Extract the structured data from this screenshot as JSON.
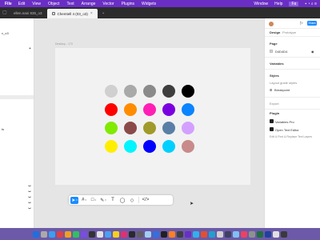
{
  "menubar": {
    "app": "File",
    "menus": [
      "Edit",
      "View",
      "Object",
      "Text",
      "Arrange",
      "Vector",
      "Plugins",
      "Widgets"
    ],
    "right": [
      "Window",
      "Help"
    ],
    "selected": "Fa"
  },
  "tabs": [
    {
      "label": "ellen.nani 835_o3"
    },
    {
      "label": "Chemtell 4 (03_o3)"
    }
  ],
  "canvas": {
    "frame_label": "Desktop - 170",
    "dots": [
      "#d0d0d0",
      "#a9a9a9",
      "#8a8a8a",
      "#3e3e3e",
      "#000000",
      "#ff0000",
      "#ff8c00",
      "#ff1fb4",
      "#7b00e0",
      "#0a84ff",
      "#80ea00",
      "#8b4a4a",
      "#a09a2a",
      "#5a7fa6",
      "#d4a0ff",
      "#ffee00",
      "#00f5ff",
      "#0000ff",
      "#00d0ff",
      "#c98a8a"
    ]
  },
  "left_panel": {
    "title": "v_o3",
    "items": [
      "",
      "",
      "ts",
      ""
    ]
  },
  "right_panel": {
    "share": "Share",
    "tabs": {
      "design": "Design",
      "prototype": "Prototype"
    },
    "page_heading": "Page",
    "page_color": "D4D4D4",
    "variables": "Variables",
    "styles_heading": "Styles",
    "layout_guide": "Layout guide styles",
    "breakpoint": "Breakpoint",
    "export": "Export",
    "plugin_heading": "Plugin",
    "plugins": [
      "Variables Pro",
      "Open Text Editor",
      "Edit & Find & Replace Text Layers"
    ]
  },
  "toolbar": {
    "tools": [
      "move",
      "frame",
      "shape",
      "pen",
      "text",
      "comment",
      "actions",
      "dev-mode"
    ]
  },
  "dock": {
    "icons": [
      "#1e6fe0",
      "#aaaaaa",
      "#3c9ef0",
      "#e04040",
      "#f0a020",
      "#30c060",
      "#7a4de0",
      "#333333",
      "#e0e0e0",
      "#4aa0f0",
      "#f5d020",
      "#e03070",
      "#2a2a2a",
      "#606060",
      "#a0d0f0",
      "#3070e0",
      "#202020",
      "#ff8020",
      "#404040",
      "#6a2ec5",
      "#30b0f0",
      "#e05030",
      "#20a0d0",
      "#d0d0d0",
      "#404060",
      "#80c0f0",
      "#f04060",
      "#909090",
      "#207040",
      "#2040a0",
      "#e0e0e0",
      "#3a3a3a"
    ]
  }
}
